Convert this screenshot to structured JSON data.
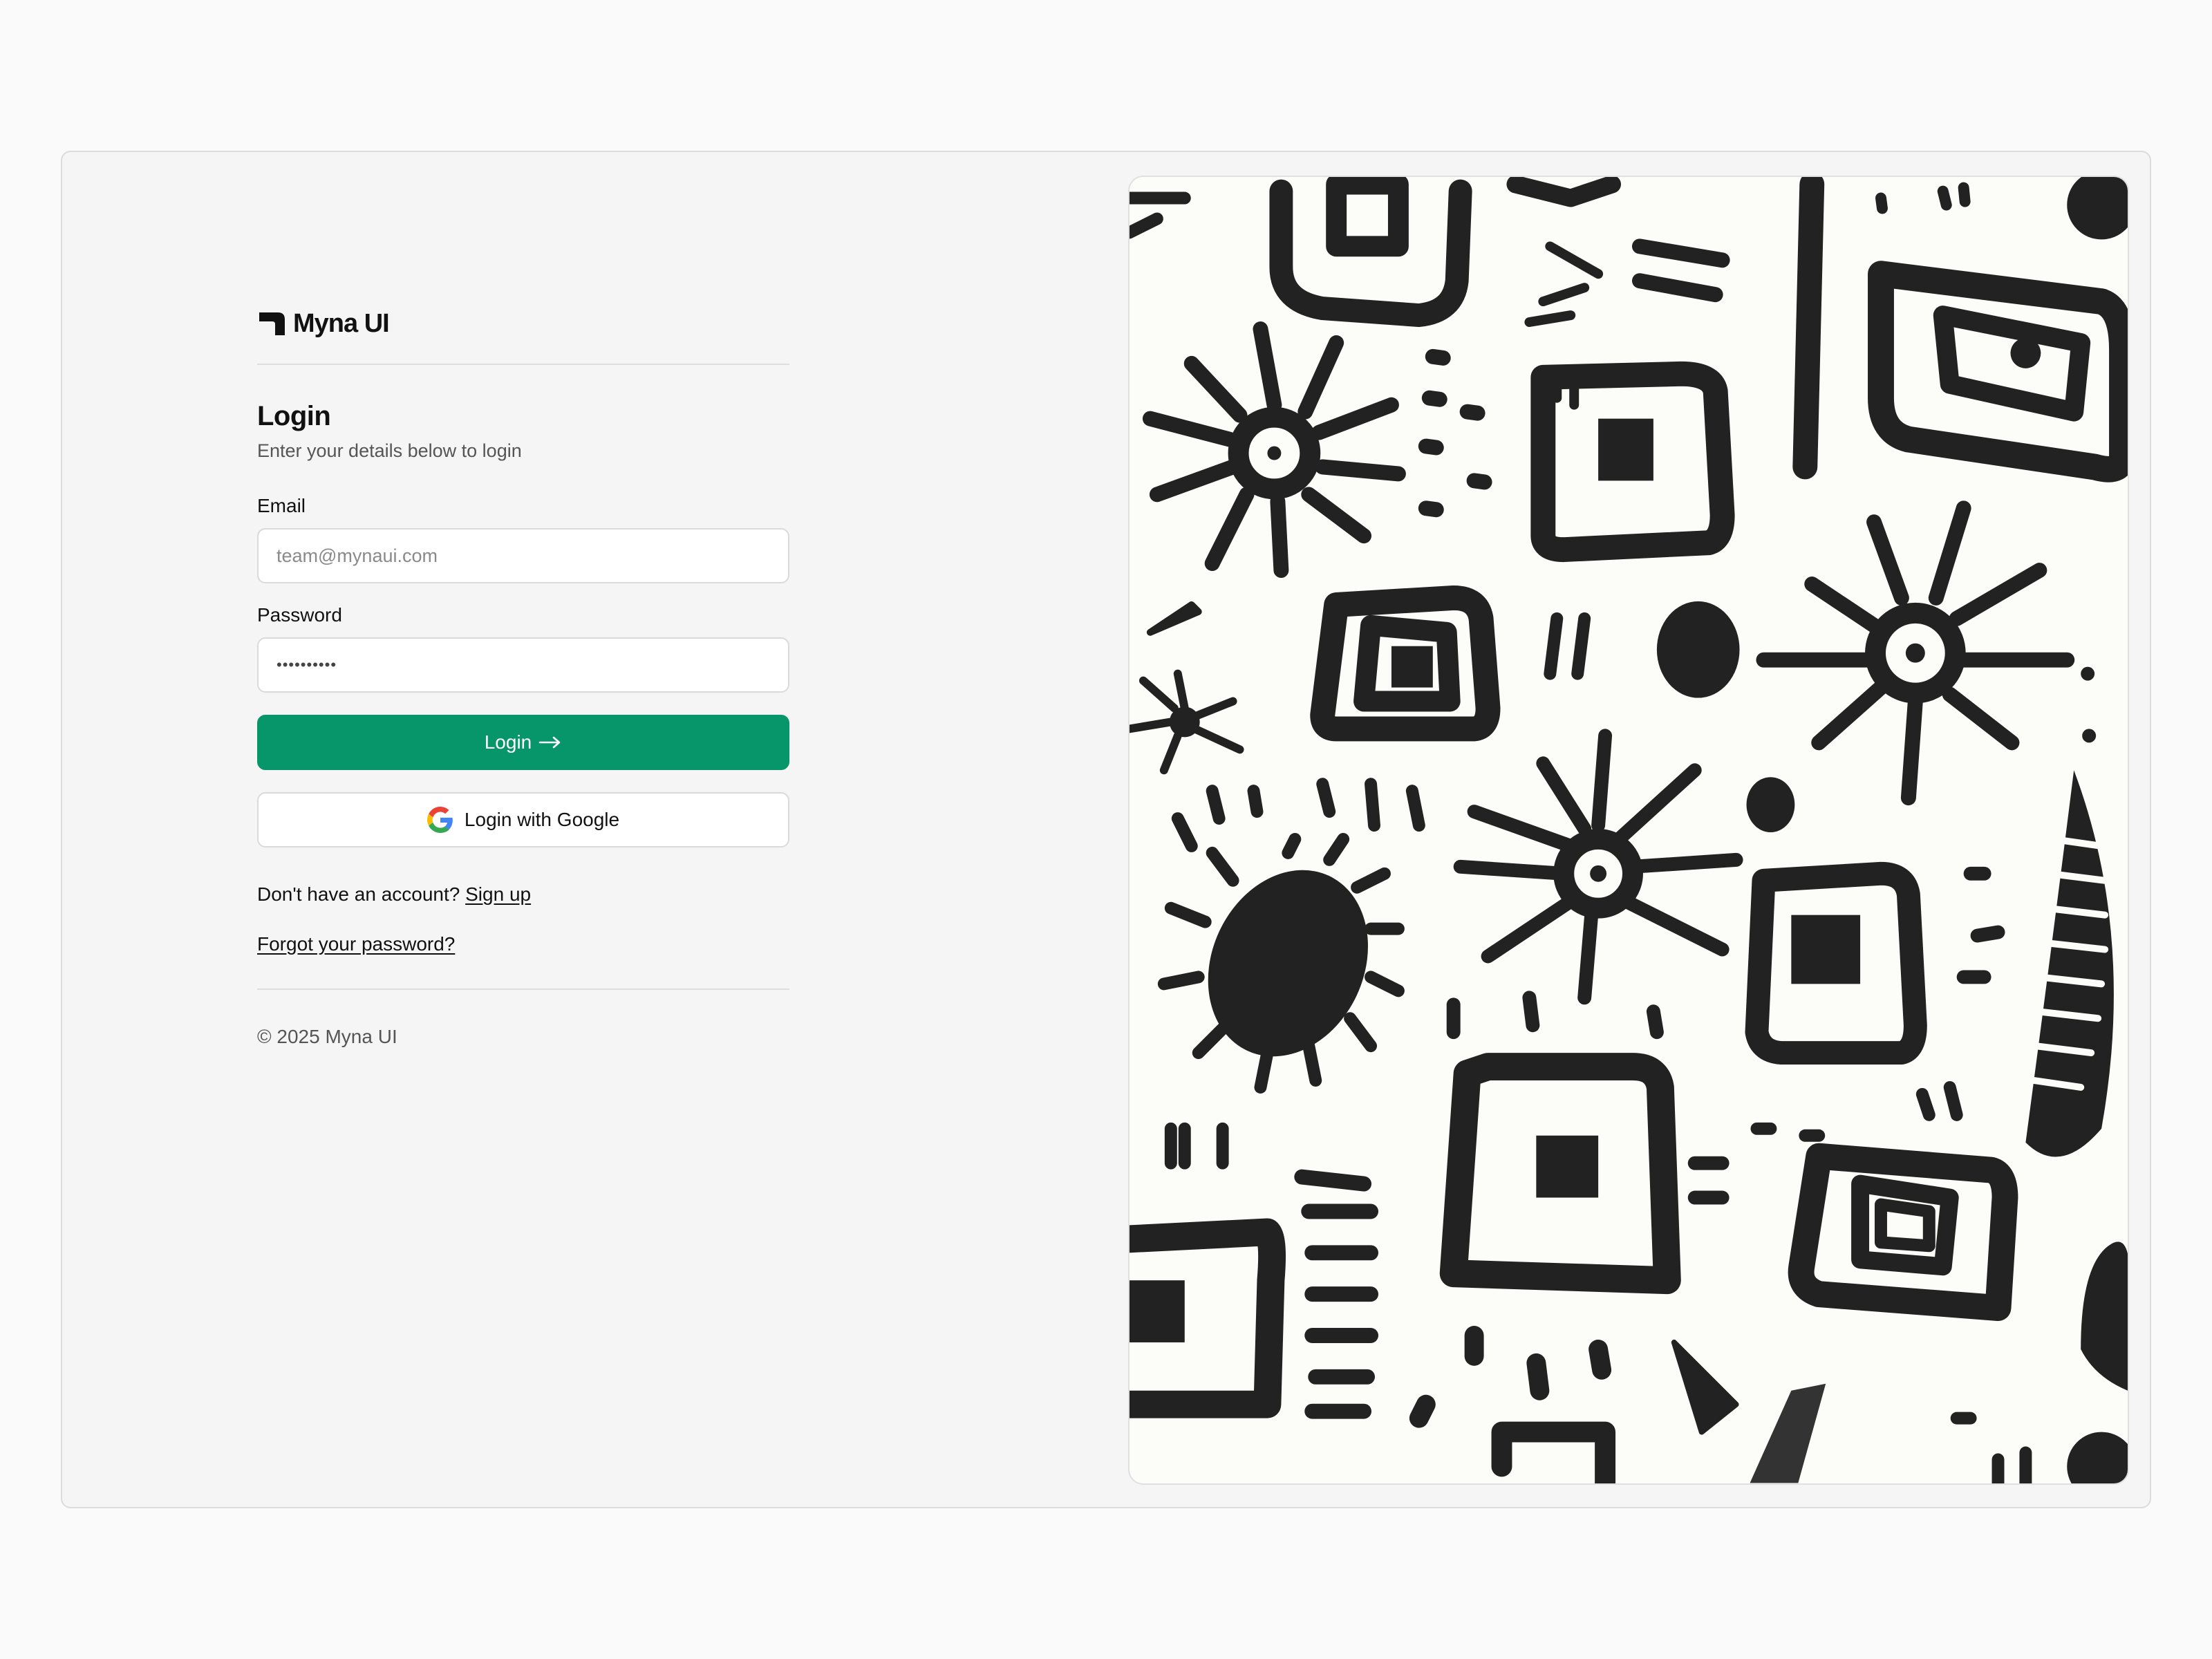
{
  "brand": {
    "name": "Myna UI"
  },
  "login": {
    "title": "Login",
    "subtitle": "Enter your details below to login",
    "email_label": "Email",
    "email_placeholder": "team@mynaui.com",
    "password_label": "Password",
    "password_value": "••••••••••",
    "login_button": "Login",
    "google_button": "Login with Google",
    "signup_prompt": "Don't have an account?",
    "signup_link": "Sign up",
    "forgot_link": "Forgot your password?"
  },
  "footer": {
    "copyright": "© 2025 Myna UI"
  },
  "colors": {
    "primary": "#07956a",
    "ink": "#222222",
    "art_background": "#fcfcf8"
  },
  "icons": {
    "brand": "myna-logo-icon",
    "login_arrow": "arrow-right-icon",
    "google": "google-icon"
  }
}
